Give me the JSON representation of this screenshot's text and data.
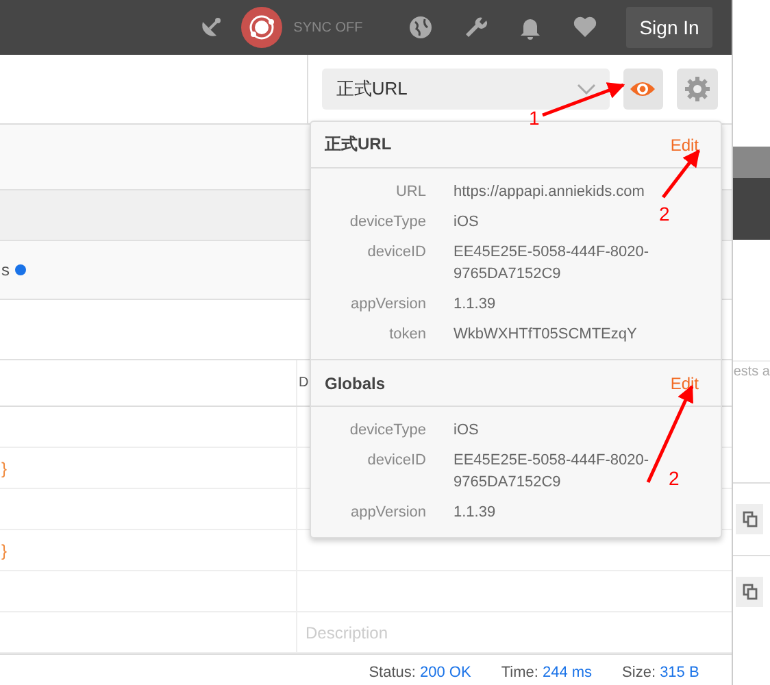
{
  "topbar": {
    "sync_label": "SYNC OFF",
    "sign_in": "Sign In"
  },
  "environment": {
    "selected": "正式URL"
  },
  "request_panel": {
    "cut_text": "s"
  },
  "table": {
    "column_2_header": "D",
    "rows": [
      {},
      {
        "key": "}"
      },
      {},
      {
        "key": "}"
      },
      {},
      {
        "placeholder": "Description"
      }
    ]
  },
  "status": [
    {
      "label": "Status:",
      "value": "200 OK"
    },
    {
      "label": "Time:",
      "value": "244 ms"
    },
    {
      "label": "Size:",
      "value": "315 B"
    }
  ],
  "side_panel": {
    "cut_text": "ests a"
  },
  "popover": {
    "sections": [
      {
        "title": "正式URL",
        "action": "Edit",
        "rows": [
          {
            "name": "URL",
            "value": "https://appapi.anniekids.com"
          },
          {
            "name": "deviceType",
            "value": "iOS"
          },
          {
            "name": "deviceID",
            "value": "EE45E25E-5058-444F-8020-9765DA7152C9"
          },
          {
            "name": "appVersion",
            "value": "1.1.39"
          },
          {
            "name": "token",
            "value": "WkbWXHTfT05SCMTEzqY"
          }
        ]
      },
      {
        "title": "Globals",
        "action": "Edit",
        "rows": [
          {
            "name": "deviceType",
            "value": "iOS"
          },
          {
            "name": "deviceID",
            "value": "EE45E25E-5058-444F-8020-9765DA7152C9"
          },
          {
            "name": "appVersion",
            "value": "1.1.39"
          }
        ]
      }
    ]
  },
  "callouts": [
    {
      "label": "1"
    },
    {
      "label": "2"
    },
    {
      "label": "2"
    }
  ]
}
